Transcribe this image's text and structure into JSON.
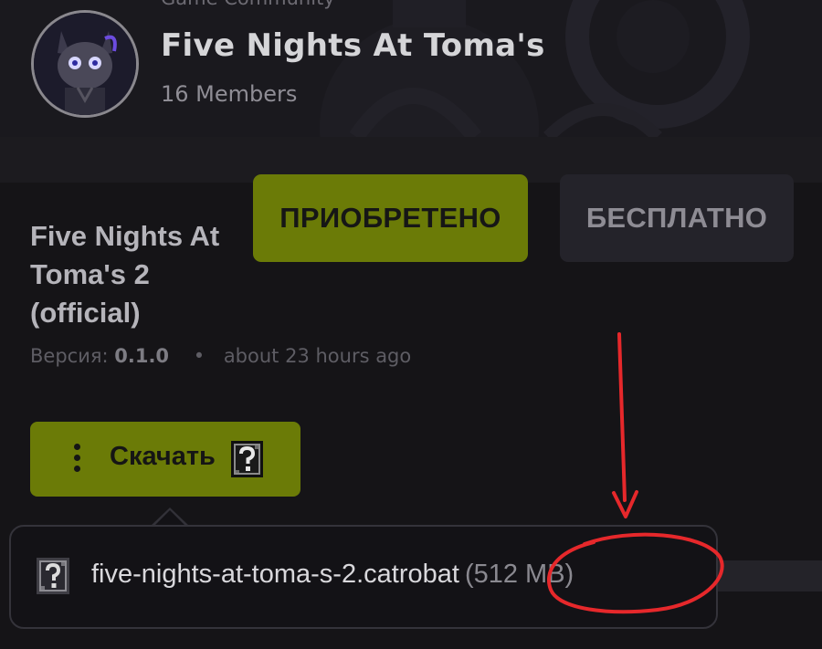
{
  "community": {
    "label": "Game Community",
    "title": "Five Nights At Toma's",
    "members": "16 Members"
  },
  "buttons": {
    "acquired": "ПРИОБРЕТЕНО",
    "free": "БЕСПЛАТНО"
  },
  "project": {
    "title": "Five Nights At Toma's 2 (official)",
    "version_label": "Версия:",
    "version_value": "0.1.0",
    "separator": "•",
    "updated": "about 23 hours ago"
  },
  "download": {
    "menu_icon": "kebab-menu-icon",
    "label": "Скачать",
    "icon": "question-box-icon"
  },
  "file": {
    "icon": "question-box-icon",
    "name": "five-nights-at-toma-s-2.catrobat",
    "size": "(512 MB)"
  },
  "annotation": {
    "color": "#e6282b"
  },
  "colors": {
    "accent": "#6b7b07",
    "background": "#151417",
    "secondary_button": "#24232a"
  }
}
